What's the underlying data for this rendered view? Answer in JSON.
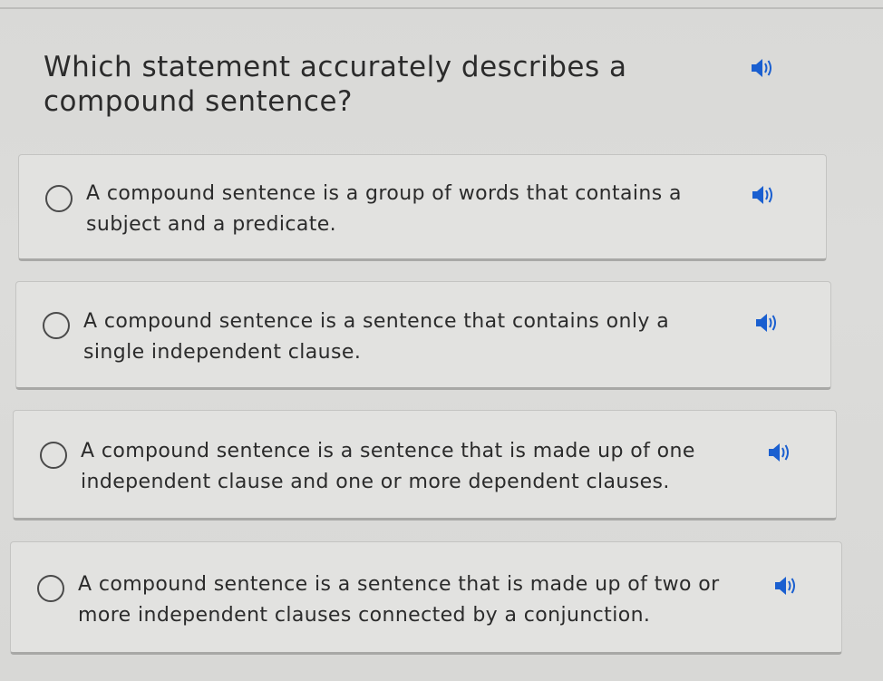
{
  "question": {
    "text": "Which statement accurately describes a compound sentence?",
    "audio_icon": "speaker-icon"
  },
  "options": [
    {
      "text": "A compound sentence is a group of words that contains a subject and a predicate."
    },
    {
      "text": "A compound sentence is a sentence that contains only a single independent clause."
    },
    {
      "text": "A compound sentence is a sentence that is made up of one independent clause and one or more dependent clauses."
    },
    {
      "text": "A compound sentence is a sentence that is made up of two or more independent clauses connected by a conjunction."
    }
  ],
  "colors": {
    "speaker_blue": "#1a5fd0",
    "background": "#dadad8",
    "card": "#e2e2e0"
  }
}
